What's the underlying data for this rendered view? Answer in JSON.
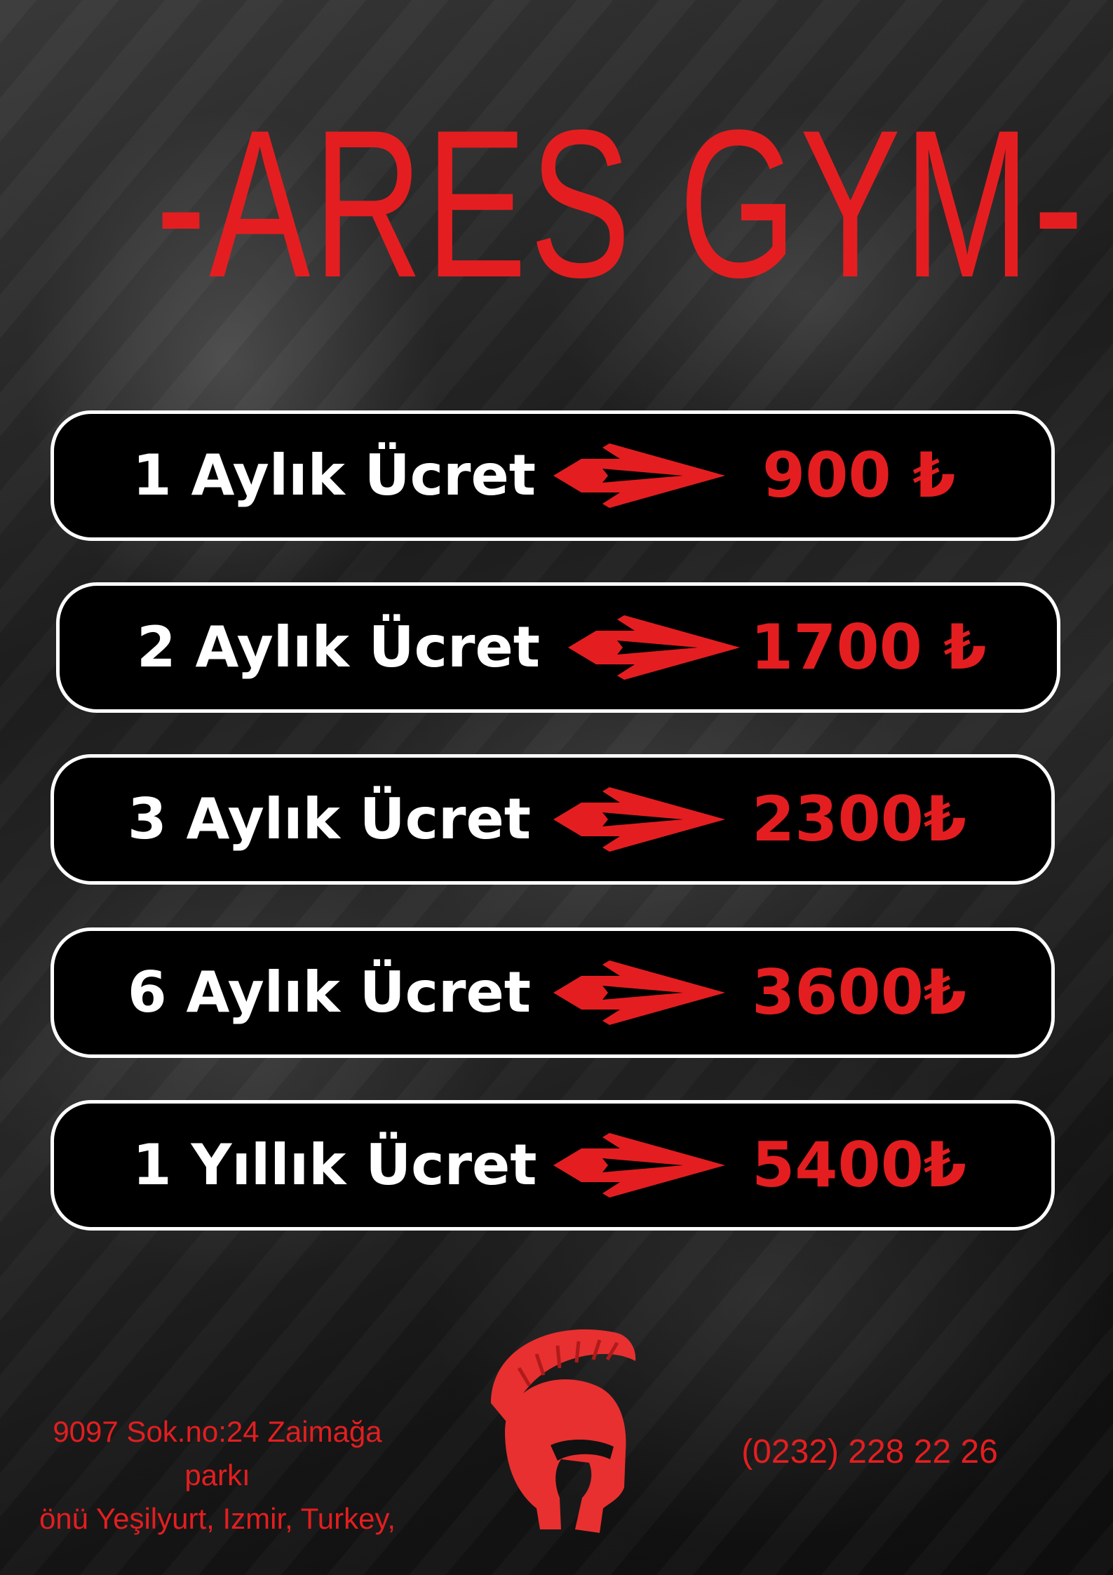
{
  "title": "-ARES GYM-",
  "colors": {
    "accent": "#e41e20",
    "row_bg": "#000000",
    "row_border": "#ffffff",
    "label": "#ffffff"
  },
  "prices": [
    {
      "label": "1 Aylık Ücret",
      "price": "900 ₺"
    },
    {
      "label": "2 Aylık Ücret",
      "price": "1700 ₺"
    },
    {
      "label": "3 Aylık Ücret",
      "price": "2300₺"
    },
    {
      "label": "6 Aylık Ücret",
      "price": "3600₺"
    },
    {
      "label": "1 Yıllık Ücret",
      "price": "5400₺"
    }
  ],
  "icons": {
    "arrow": "arrow-right-icon",
    "logo": "spartan-helmet-icon"
  },
  "footer": {
    "address_line1": "9097 Sok.no:24 Zaimağa parkı",
    "address_line2": "önü Yeşilyurt, Izmir, Turkey,",
    "phone": "(0232) 228 22 26"
  }
}
